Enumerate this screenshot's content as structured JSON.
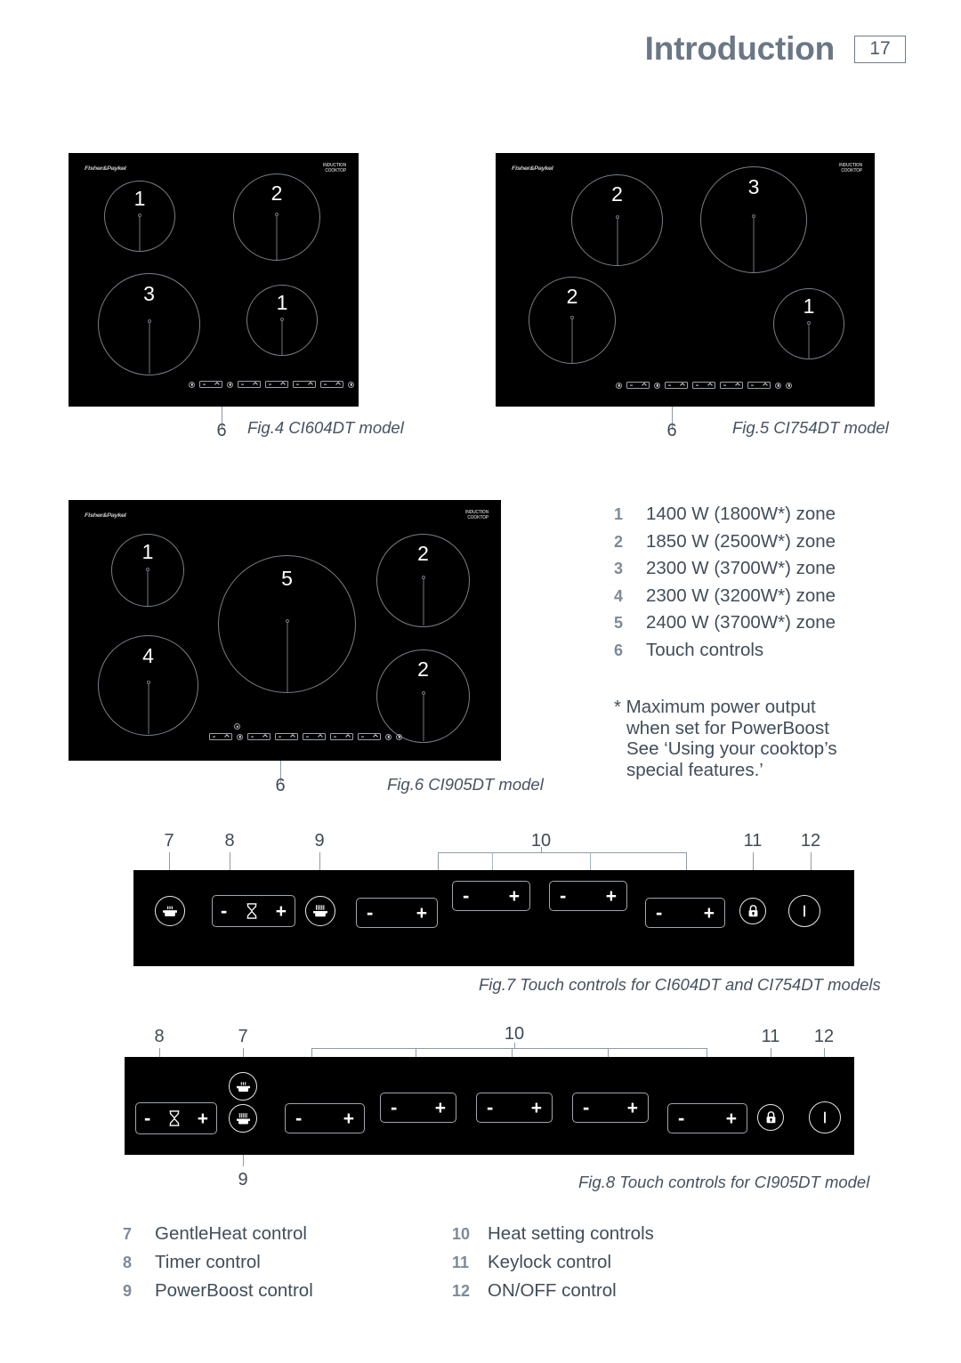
{
  "header": {
    "title": "Introduction",
    "page_number": "17"
  },
  "brand": "Fisher&Paykel",
  "figures": [
    {
      "id": "fig4",
      "caption": "Fig.4 CI604DT model",
      "callout": "6",
      "model_mark": "INDUCTION\nCOOKTOP",
      "zones": [
        {
          "label": "1"
        },
        {
          "label": "2"
        },
        {
          "label": "3"
        },
        {
          "label": "1"
        }
      ]
    },
    {
      "id": "fig5",
      "caption": "Fig.5 CI754DT model",
      "callout": "6",
      "model_mark": "INDUCTION",
      "zones": [
        {
          "label": "2"
        },
        {
          "label": "3"
        },
        {
          "label": "2"
        },
        {
          "label": "1"
        }
      ]
    },
    {
      "id": "fig6",
      "caption": "Fig.6 CI905DT model",
      "callout": "6",
      "model_mark": "INDUCTION\nCOOKTOP",
      "zones": [
        {
          "label": "1"
        },
        {
          "label": "5"
        },
        {
          "label": "2"
        },
        {
          "label": "4"
        },
        {
          "label": "2"
        }
      ]
    }
  ],
  "zone_list": [
    {
      "num": "1",
      "text": "1400 W (1800W*) zone"
    },
    {
      "num": "2",
      "text": "1850 W (2500W*) zone"
    },
    {
      "num": "3",
      "text": "2300 W (3700W*) zone"
    },
    {
      "num": "4",
      "text": "2300 W (3200W*) zone"
    },
    {
      "num": "5",
      "text": "2400 W (3700W*) zone"
    },
    {
      "num": "6",
      "text": "Touch controls"
    }
  ],
  "footnote": {
    "line1": "* Maximum power output",
    "line2": "when set for PowerBoost",
    "line3": "See ‘Using your cooktop’s",
    "line4": "special features.’"
  },
  "touch_panel_604": {
    "caption": "Fig.7 Touch controls for CI604DT and CI754DT models",
    "callouts": [
      {
        "num": "7"
      },
      {
        "num": "8"
      },
      {
        "num": "9"
      },
      {
        "num": "10"
      },
      {
        "num": "11"
      },
      {
        "num": "12"
      }
    ],
    "minus": "-",
    "plus": "+"
  },
  "touch_panel_905": {
    "caption": "Fig.8 Touch controls for CI905DT model",
    "callouts": [
      {
        "num": "8"
      },
      {
        "num": "7"
      },
      {
        "num": "10"
      },
      {
        "num": "11"
      },
      {
        "num": "12"
      },
      {
        "num": "9"
      }
    ],
    "minus": "-",
    "plus": "+"
  },
  "legend": {
    "left": [
      {
        "num": "7",
        "label": "GentleHeat control"
      },
      {
        "num": "8",
        "label": "Timer control"
      },
      {
        "num": "9",
        "label": "PowerBoost control"
      }
    ],
    "right": [
      {
        "num": "10",
        "label": "Heat setting controls"
      },
      {
        "num": "11",
        "label": "Keylock control"
      },
      {
        "num": "12",
        "label": "ON/OFF control"
      }
    ]
  },
  "colors": {
    "heading": "#6b7785",
    "body_text": "#414d59",
    "list_number": "#7d8a98",
    "leader_line": "#8f9aa8",
    "cooktop_black": "#000000",
    "zone_outline": "#777f86"
  }
}
